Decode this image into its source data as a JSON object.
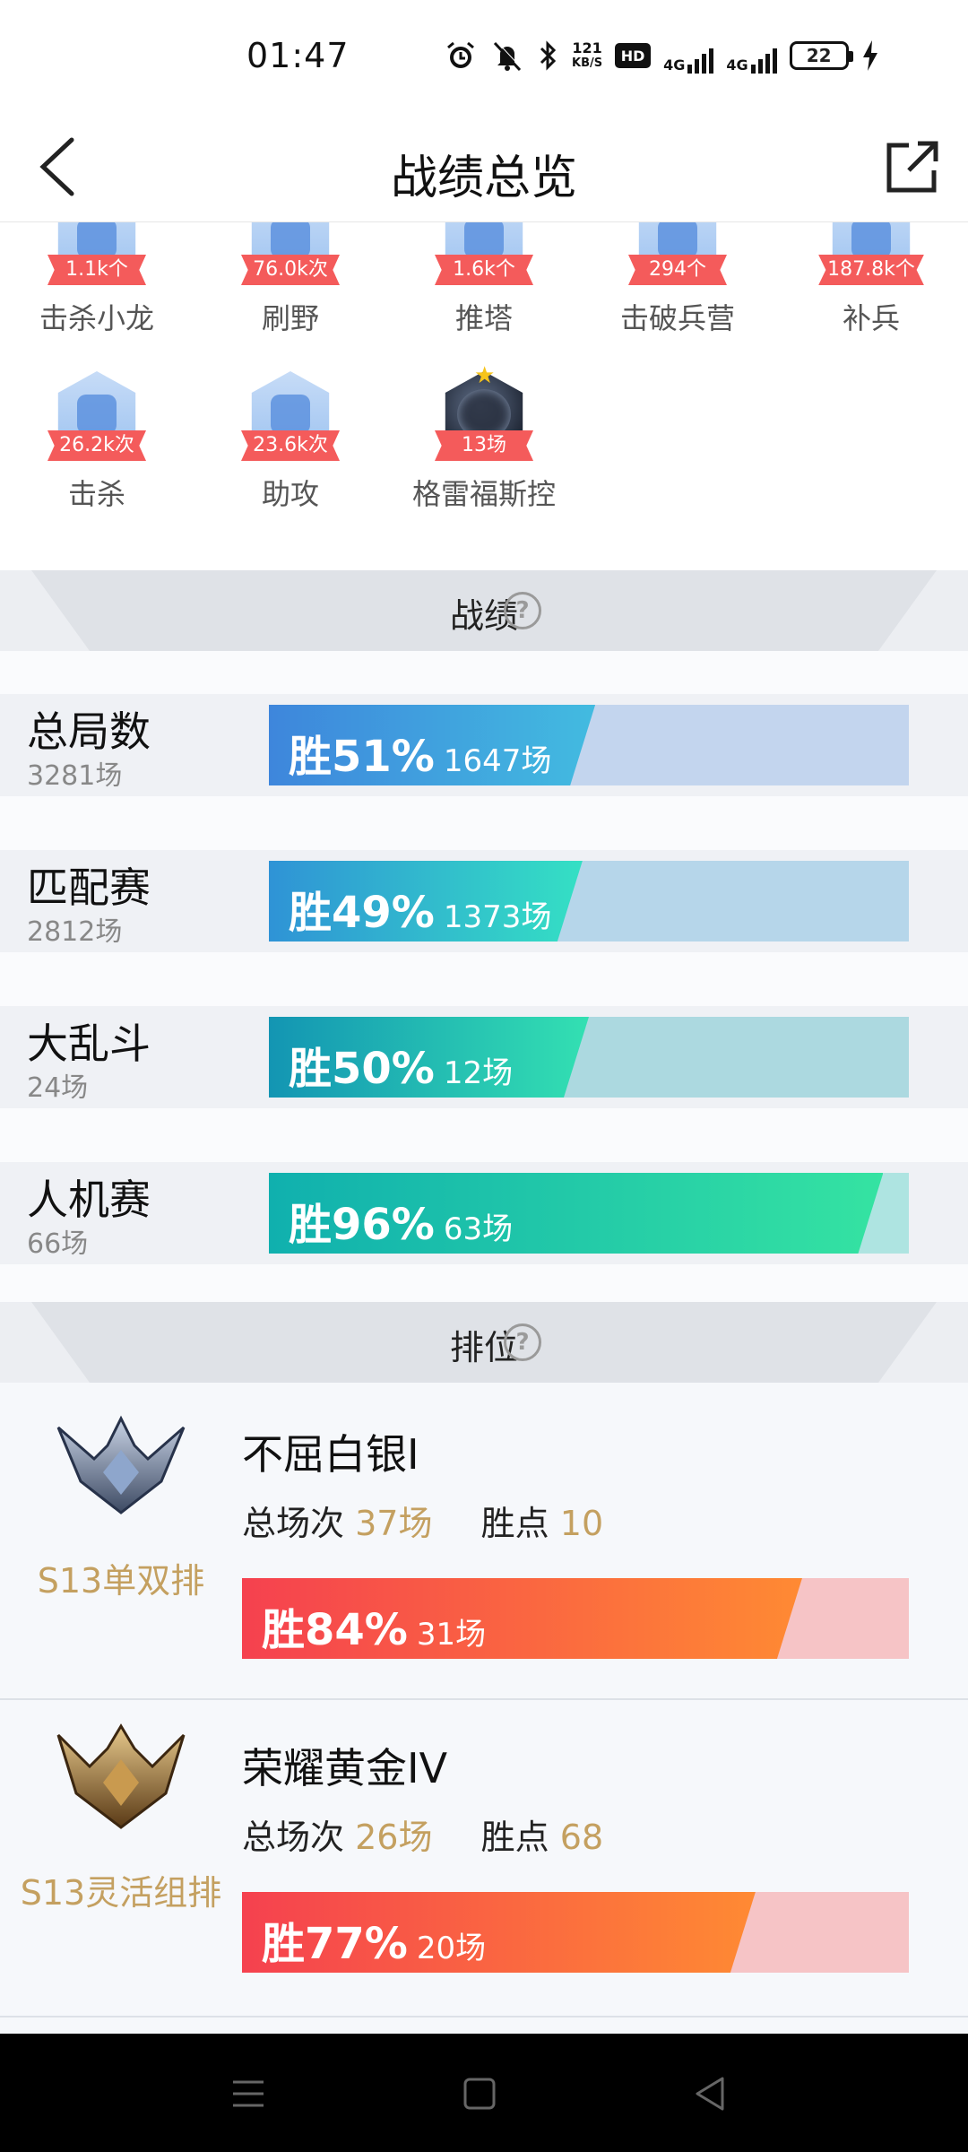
{
  "status_bar": {
    "time": "01:47",
    "net_speed_value": "121",
    "net_speed_unit": "KB/S",
    "hd_label": "HD",
    "sim1_label": "4G",
    "sim2_label": "4G",
    "battery": "22"
  },
  "header": {
    "title": "战绩总览"
  },
  "badges": [
    {
      "value": "1.1k个",
      "label": "击杀小龙"
    },
    {
      "value": "76.0k次",
      "label": "刷野"
    },
    {
      "value": "1.6k个",
      "label": "推塔"
    },
    {
      "value": "294个",
      "label": "击破兵营"
    },
    {
      "value": "187.8k个",
      "label": "补兵"
    },
    {
      "value": "26.2k次",
      "label": "击杀"
    },
    {
      "value": "23.6k次",
      "label": "助攻"
    },
    {
      "value": "13场",
      "label": "格雷福斯控"
    }
  ],
  "stats_section": {
    "title": "战绩",
    "help": "?",
    "rows": [
      {
        "name": "总局数",
        "total": "3281场",
        "win_label": "胜51%",
        "win_rate": 0.51,
        "win_count": "1647场"
      },
      {
        "name": "匹配赛",
        "total": "2812场",
        "win_label": "胜49%",
        "win_rate": 0.49,
        "win_count": "1373场"
      },
      {
        "name": "大乱斗",
        "total": "24场",
        "win_label": "胜50%",
        "win_rate": 0.5,
        "win_count": "12场"
      },
      {
        "name": "人机赛",
        "total": "66场",
        "win_label": "胜96%",
        "win_rate": 0.96,
        "win_count": "63场"
      }
    ]
  },
  "ranked_section": {
    "title": "排位",
    "help": "?",
    "entries": [
      {
        "season": "S13单双排",
        "tier": "不屈白银I",
        "games_label": "总场次",
        "games": "37场",
        "points_label": "胜点",
        "points": "10",
        "win_label": "胜84%",
        "win_rate": 0.84,
        "win_count": "31场"
      },
      {
        "season": "S13灵活组排",
        "tier": "荣耀黄金IV",
        "games_label": "总场次",
        "games": "26场",
        "points_label": "胜点",
        "points": "68",
        "win_label": "胜77%",
        "win_rate": 0.77,
        "win_count": "20场"
      }
    ]
  },
  "colors": {
    "stat_fills": [
      [
        "#3e86dc",
        "#42bbe0"
      ],
      [
        "#2f93d6",
        "#34e0c4"
      ],
      [
        "#1395b3",
        "#33e0b2"
      ],
      [
        "#10b0ae",
        "#35e3a2"
      ]
    ],
    "stat_tracks": [
      "#c3d5ee",
      "#b6d6ea",
      "#acd9e0",
      "#aee4e1"
    ],
    "rank_fill": [
      "#f5414f",
      "#ff8a33"
    ],
    "gold_text": "#c4a060"
  }
}
